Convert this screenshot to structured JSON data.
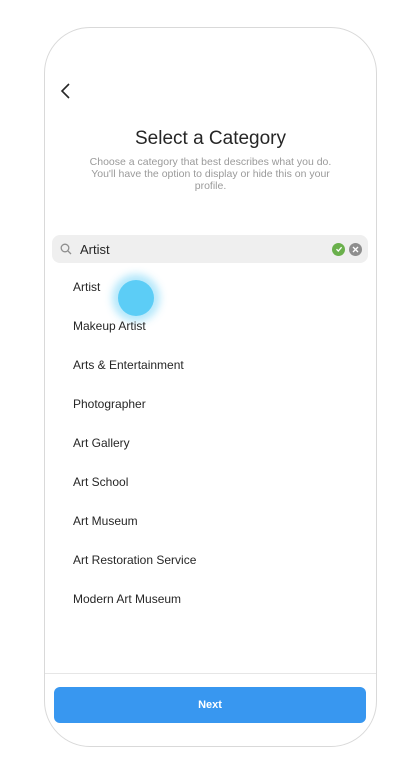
{
  "header": {
    "back_icon": "chevron-left-icon",
    "title": "Select a Category",
    "subtitle": "Choose a category that best describes what you do. You'll have the option to display or hide this on your profile."
  },
  "search": {
    "value": "Artist",
    "icon": "search-icon",
    "status_icon": "check-circle-icon",
    "status_color": "#6ab04c",
    "clear_icon": "clear-icon"
  },
  "categories": [
    "Artist",
    "Makeup Artist",
    "Arts & Entertainment",
    "Photographer",
    "Art Gallery",
    "Art School",
    "Art Museum",
    "Art Restoration Service",
    "Modern Art Museum"
  ],
  "footer": {
    "next_label": "Next",
    "accent": "#3897f0"
  }
}
